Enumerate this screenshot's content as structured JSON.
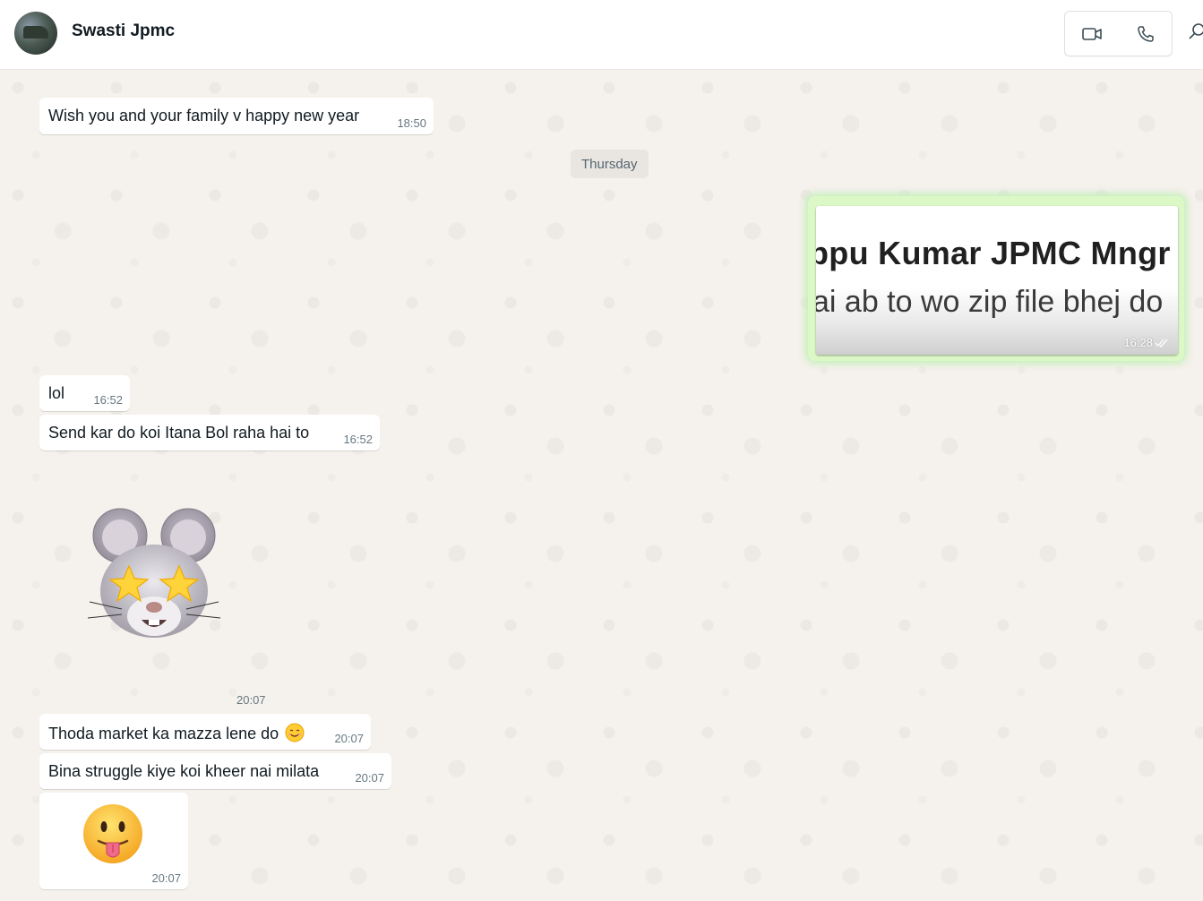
{
  "header": {
    "contact_name": "Swasti Jpmc",
    "avatar_icon": "contact-avatar",
    "actions": [
      {
        "name": "video-call",
        "icon": "video-camera-icon"
      },
      {
        "name": "voice-call",
        "icon": "phone-icon"
      },
      {
        "name": "search",
        "icon": "search-icon"
      }
    ]
  },
  "chat": {
    "date_divider": "Thursday",
    "messages": [
      {
        "dir": "in",
        "text": "Wish you and your family v happy new year",
        "time": "18:50"
      },
      {
        "dir": "out",
        "type": "image",
        "image_text_line1": "ppu Kumar JPMC Mngr",
        "image_text_line2": "ai ab to wo zip file bhej do",
        "time": "16:28",
        "status": "read-double-tick"
      },
      {
        "dir": "in",
        "text": "lol",
        "time": "16:52"
      },
      {
        "dir": "in",
        "text": "Send kar do koi Itana Bol raha hai to",
        "time": "16:52"
      },
      {
        "dir": "in",
        "type": "sticker",
        "sticker": "mouse-star-eyes",
        "time": "20:07"
      },
      {
        "dir": "in",
        "text": "Thoda market ka mazza lene do",
        "emoji": "smiling-face",
        "time": "20:07"
      },
      {
        "dir": "in",
        "text": "Bina struggle kiye koi kheer nai milata",
        "time": "20:07"
      },
      {
        "dir": "in",
        "type": "emoji",
        "emoji": "face-with-tongue",
        "time": "20:07"
      }
    ]
  },
  "colors": {
    "chat_bg": "#f5f1ec",
    "incoming_bubble": "#ffffff",
    "outgoing_bubble": "#dcf8c6",
    "timestamp": "#667781"
  }
}
